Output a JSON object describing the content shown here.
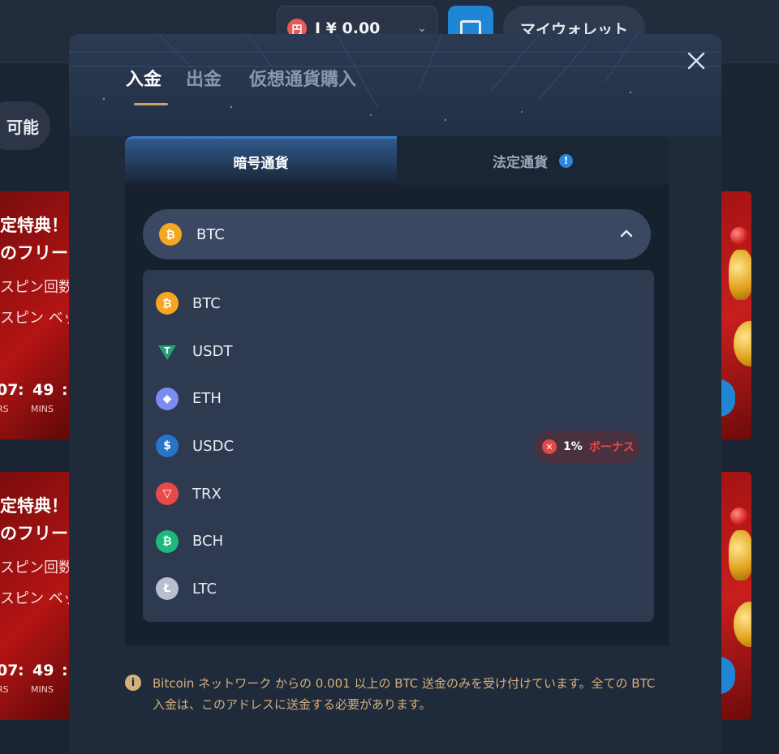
{
  "topbar": {
    "currency_symbol": "円",
    "balance": "I ¥ 0.00",
    "wallet_icon": "wallet-icon",
    "my_wallet_label": "マイウォレット"
  },
  "background": {
    "chip_label": "可能",
    "promos": [
      {
        "line1": "定特典！",
        "line2": "のフリース",
        "line3": "スピン回数",
        "line4": "スピン ベッ",
        "hours": "07",
        "mins": "49",
        "hours_label": "RS",
        "mins_label": "MINS"
      },
      {
        "line1": "定特典！",
        "line2": "のフリース",
        "line3": "スピン回数",
        "line4": "スピン ベッ",
        "hours": "07",
        "mins": "49",
        "hours_label": "RS",
        "mins_label": "MINS"
      }
    ]
  },
  "modal": {
    "tabs": [
      {
        "label": "入金",
        "active": true
      },
      {
        "label": "出金",
        "active": false
      },
      {
        "label": "仮想通貨購入",
        "active": false
      }
    ],
    "close_icon": "close-icon",
    "segments": {
      "crypto": "暗号通貨",
      "fiat": "法定通貨",
      "fiat_info": "!"
    },
    "selected_currency": "BTC",
    "currencies": [
      {
        "code": "BTC",
        "icon": "btc-icon",
        "glyph": "₿"
      },
      {
        "code": "USDT",
        "icon": "usdt-icon",
        "glyph": "T"
      },
      {
        "code": "ETH",
        "icon": "eth-icon",
        "glyph": "◆"
      },
      {
        "code": "USDC",
        "icon": "usdc-icon",
        "glyph": "$"
      },
      {
        "code": "TRX",
        "icon": "trx-icon",
        "glyph": "▽"
      },
      {
        "code": "BCH",
        "icon": "bch-icon",
        "glyph": "₿"
      },
      {
        "code": "LTC",
        "icon": "ltc-icon",
        "glyph": "Ł"
      }
    ],
    "bonus": {
      "percent": "1%",
      "label": "ボーナス",
      "x": "✕"
    },
    "note_icon": "i",
    "note": "Bitcoin ネットワーク からの 0.001 以上の BTC 送金のみを受け付けています。全ての BTC 入金は、このアドレスに送金する必要があります。"
  },
  "colors": {
    "accent_blue": "#1f86d6",
    "tab_underline": "#c9a46a",
    "bonus_red": "#ee4a4a",
    "note_text": "#d5b07c"
  }
}
